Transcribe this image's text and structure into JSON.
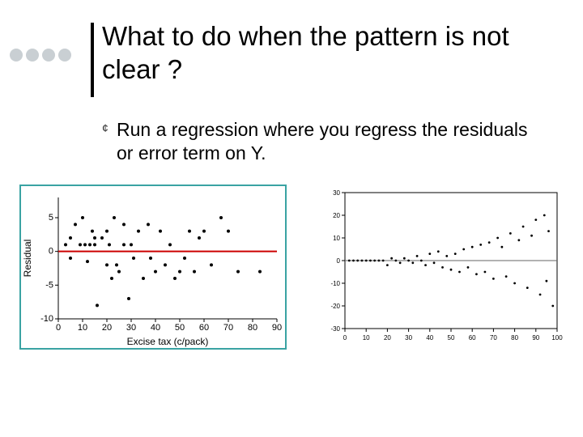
{
  "title": "What to do when the pattern is not clear ?",
  "bullet": {
    "mark": "¢",
    "text": "Run a regression where you regress the residuals or error term on Y."
  },
  "chart_data": [
    {
      "type": "scatter",
      "title": "",
      "xlabel": "Excise tax (c/pack)",
      "ylabel": "Residual",
      "xlim": [
        0,
        90
      ],
      "ylim": [
        -10,
        8
      ],
      "xticks": [
        0,
        10,
        20,
        30,
        40,
        50,
        60,
        70,
        80,
        90
      ],
      "yticks": [
        -10,
        -5,
        0,
        5
      ],
      "reference_line_y": 0,
      "points": [
        {
          "x": 3,
          "y": 1
        },
        {
          "x": 5,
          "y": 2
        },
        {
          "x": 5,
          "y": -1
        },
        {
          "x": 7,
          "y": 4
        },
        {
          "x": 9,
          "y": 1
        },
        {
          "x": 10,
          "y": 5
        },
        {
          "x": 11,
          "y": 1
        },
        {
          "x": 12,
          "y": -1.5
        },
        {
          "x": 13,
          "y": 1
        },
        {
          "x": 14,
          "y": 3
        },
        {
          "x": 15,
          "y": 2
        },
        {
          "x": 15,
          "y": 1
        },
        {
          "x": 16,
          "y": -8
        },
        {
          "x": 18,
          "y": 2
        },
        {
          "x": 20,
          "y": -2
        },
        {
          "x": 20,
          "y": 3
        },
        {
          "x": 21,
          "y": 1
        },
        {
          "x": 22,
          "y": -4
        },
        {
          "x": 23,
          "y": 5
        },
        {
          "x": 24,
          "y": -2
        },
        {
          "x": 25,
          "y": -3
        },
        {
          "x": 27,
          "y": 4
        },
        {
          "x": 27,
          "y": 1
        },
        {
          "x": 29,
          "y": -7
        },
        {
          "x": 30,
          "y": 1
        },
        {
          "x": 31,
          "y": -1
        },
        {
          "x": 33,
          "y": 3
        },
        {
          "x": 35,
          "y": -4
        },
        {
          "x": 37,
          "y": 4
        },
        {
          "x": 38,
          "y": -1
        },
        {
          "x": 40,
          "y": -3
        },
        {
          "x": 42,
          "y": 3
        },
        {
          "x": 44,
          "y": -2
        },
        {
          "x": 46,
          "y": 1
        },
        {
          "x": 48,
          "y": -4
        },
        {
          "x": 50,
          "y": -3
        },
        {
          "x": 52,
          "y": -1
        },
        {
          "x": 54,
          "y": 3
        },
        {
          "x": 56,
          "y": -3
        },
        {
          "x": 58,
          "y": 2
        },
        {
          "x": 60,
          "y": 3
        },
        {
          "x": 63,
          "y": -2
        },
        {
          "x": 67,
          "y": 5
        },
        {
          "x": 70,
          "y": 3
        },
        {
          "x": 74,
          "y": -3
        },
        {
          "x": 83,
          "y": -3
        }
      ]
    },
    {
      "type": "scatter",
      "title": "",
      "xlabel": "",
      "ylabel": "",
      "xlim": [
        0,
        100
      ],
      "ylim": [
        -30,
        30
      ],
      "xticks": [
        0,
        10,
        20,
        30,
        40,
        50,
        60,
        70,
        80,
        90,
        100
      ],
      "yticks": [
        -30,
        -20,
        -10,
        0,
        10,
        20,
        30
      ],
      "reference_line_y": 0,
      "points": [
        {
          "x": 2,
          "y": 0
        },
        {
          "x": 4,
          "y": 0
        },
        {
          "x": 6,
          "y": 0
        },
        {
          "x": 8,
          "y": 0
        },
        {
          "x": 10,
          "y": 0
        },
        {
          "x": 12,
          "y": 0
        },
        {
          "x": 14,
          "y": 0
        },
        {
          "x": 16,
          "y": 0
        },
        {
          "x": 18,
          "y": 0
        },
        {
          "x": 20,
          "y": -2
        },
        {
          "x": 22,
          "y": 1
        },
        {
          "x": 24,
          "y": 0
        },
        {
          "x": 26,
          "y": -1
        },
        {
          "x": 28,
          "y": 1
        },
        {
          "x": 30,
          "y": 0
        },
        {
          "x": 32,
          "y": -1
        },
        {
          "x": 34,
          "y": 2
        },
        {
          "x": 36,
          "y": 0
        },
        {
          "x": 38,
          "y": -2
        },
        {
          "x": 40,
          "y": 3
        },
        {
          "x": 42,
          "y": -1
        },
        {
          "x": 44,
          "y": 4
        },
        {
          "x": 46,
          "y": -3
        },
        {
          "x": 48,
          "y": 2
        },
        {
          "x": 50,
          "y": -4
        },
        {
          "x": 52,
          "y": 3
        },
        {
          "x": 54,
          "y": -5
        },
        {
          "x": 56,
          "y": 5
        },
        {
          "x": 58,
          "y": -3
        },
        {
          "x": 60,
          "y": 6
        },
        {
          "x": 62,
          "y": -6
        },
        {
          "x": 64,
          "y": 7
        },
        {
          "x": 66,
          "y": -5
        },
        {
          "x": 68,
          "y": 8
        },
        {
          "x": 70,
          "y": -8
        },
        {
          "x": 72,
          "y": 10
        },
        {
          "x": 74,
          "y": 6
        },
        {
          "x": 76,
          "y": -7
        },
        {
          "x": 78,
          "y": 12
        },
        {
          "x": 80,
          "y": -10
        },
        {
          "x": 82,
          "y": 9
        },
        {
          "x": 84,
          "y": 15
        },
        {
          "x": 86,
          "y": -12
        },
        {
          "x": 88,
          "y": 11
        },
        {
          "x": 90,
          "y": 18
        },
        {
          "x": 92,
          "y": -15
        },
        {
          "x": 94,
          "y": 20
        },
        {
          "x": 95,
          "y": -9
        },
        {
          "x": 96,
          "y": 13
        },
        {
          "x": 98,
          "y": -20
        }
      ]
    }
  ]
}
